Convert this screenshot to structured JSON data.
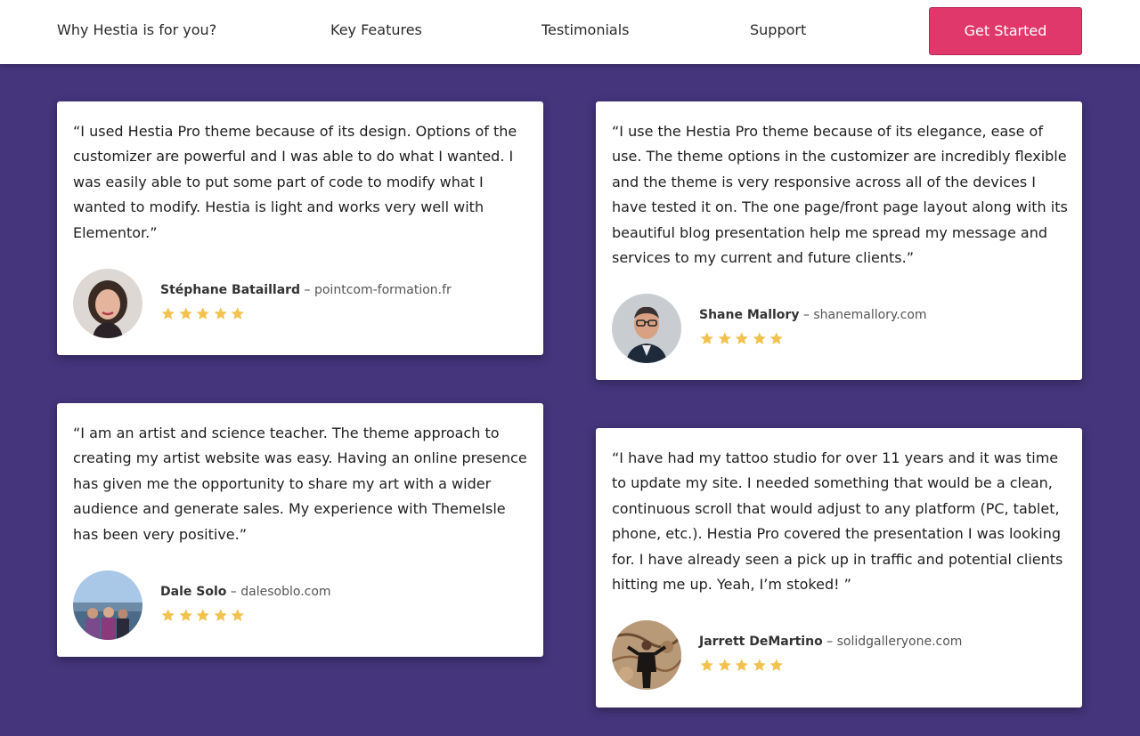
{
  "nav": {
    "links": [
      "Why Hestia is for you?",
      "Key Features",
      "Testimonials",
      "Support"
    ],
    "cta_label": "Get Started"
  },
  "colors": {
    "background": "#44357c",
    "cta": "#e0386b",
    "star": "#f2c14e"
  },
  "testimonials": [
    {
      "quote": "“I used Hestia Pro theme because of its design. Options of the customizer are powerful and I was able to do what I wanted. I was easily able to put some part of code to modify what I wanted to modify. Hestia is light and works very well with Elementor.”",
      "name": "Stéphane Bataillard",
      "separator": " – ",
      "site": "pointcom-formation.fr",
      "rating": 5,
      "avatar_icon": "portrait-woman-photo"
    },
    {
      "quote": "“I use the Hestia Pro theme because of its elegance, ease of use. The theme options in the customizer are incredibly flexible and the theme is very responsive across all of the devices I have tested it on. The one page/front page layout along with its beautiful blog presentation help me spread my message and services to my current and future clients.”",
      "name": "Shane Mallory",
      "separator": " – ",
      "site": "shanemallory.com",
      "rating": 5,
      "avatar_icon": "portrait-man-glasses-photo"
    },
    {
      "quote": "“I am an artist and science teacher. The theme approach to creating my artist website was easy. Having an online presence has given me the opportunity to share my art with a wider audience and generate sales. My experience with ThemeIsle has been very positive.”",
      "name": "Dale Solo",
      "separator": " – ",
      "site": "dalesoblo.com",
      "rating": 5,
      "avatar_icon": "group-waterfront-photo"
    },
    {
      "quote": "“I have had my tattoo studio for over 11 years and it was time to update my site. I needed something that would be a clean, continuous scroll that would adjust to any platform (PC, tablet, phone, etc.). Hestia Pro covered the presentation I was looking for. I have already seen a pick up in traffic and potential clients hitting me up. Yeah, I’m stoked! ”",
      "name": "Jarrett DeMartino",
      "separator": " – ",
      "site": "solidgalleryone.com",
      "rating": 5,
      "avatar_icon": "man-mural-photo"
    }
  ]
}
